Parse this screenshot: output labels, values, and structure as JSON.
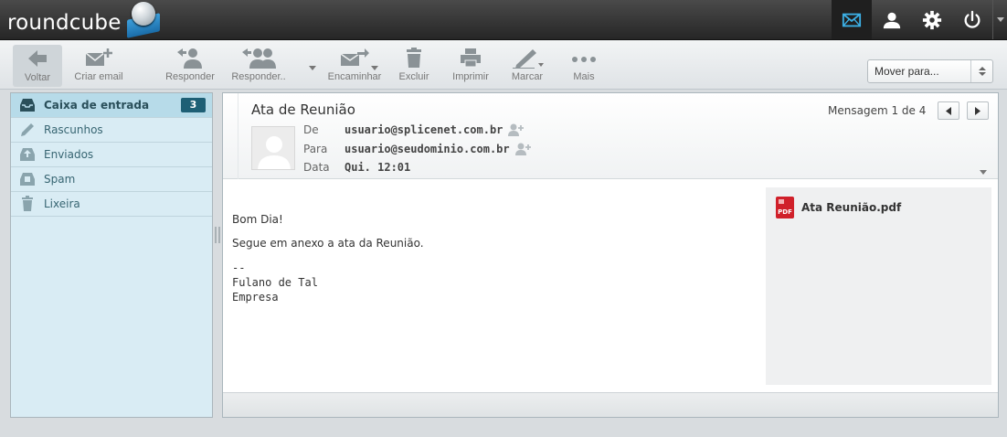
{
  "app": {
    "name": "roundcube"
  },
  "topnav": {
    "items": [
      "mail-icon",
      "contacts-icon",
      "settings-icon",
      "logout-icon"
    ],
    "active": "mail"
  },
  "toolbar": {
    "back": "Voltar",
    "compose": "Criar email",
    "reply": "Responder",
    "reply_all": "Responder..",
    "forward": "Encaminhar",
    "delete": "Excluir",
    "print": "Imprimir",
    "mark": "Marcar",
    "more": "Mais",
    "move_placeholder": "Mover para..."
  },
  "folders": [
    {
      "name": "Caixa de entrada",
      "icon": "inbox-icon",
      "unread": "3",
      "selected": true
    },
    {
      "name": "Rascunhos",
      "icon": "drafts-icon"
    },
    {
      "name": "Enviados",
      "icon": "sent-icon"
    },
    {
      "name": "Spam",
      "icon": "spam-icon"
    },
    {
      "name": "Lixeira",
      "icon": "trash-icon"
    }
  ],
  "message": {
    "subject": "Ata de Reunião",
    "from_label": "De",
    "from": "usuario@splicenet.com.br",
    "to_label": "Para",
    "to": "usuario@seudominio.com.br",
    "date_label": "Data",
    "date": "Qui. 12:01",
    "counter": "Mensagem 1 de 4",
    "body_greeting": "Bom Dia!",
    "body_text": "Segue em anexo a ata da Reunião.",
    "signature": "--\nFulano de Tal\nEmpresa",
    "attachment": "Ata Reunião.pdf"
  },
  "colors": {
    "accent": "#1e5f75",
    "sidebar_bg": "#d9ecf4",
    "selected_bg": "#b7dbe9",
    "pdf_red": "#d0202a"
  }
}
